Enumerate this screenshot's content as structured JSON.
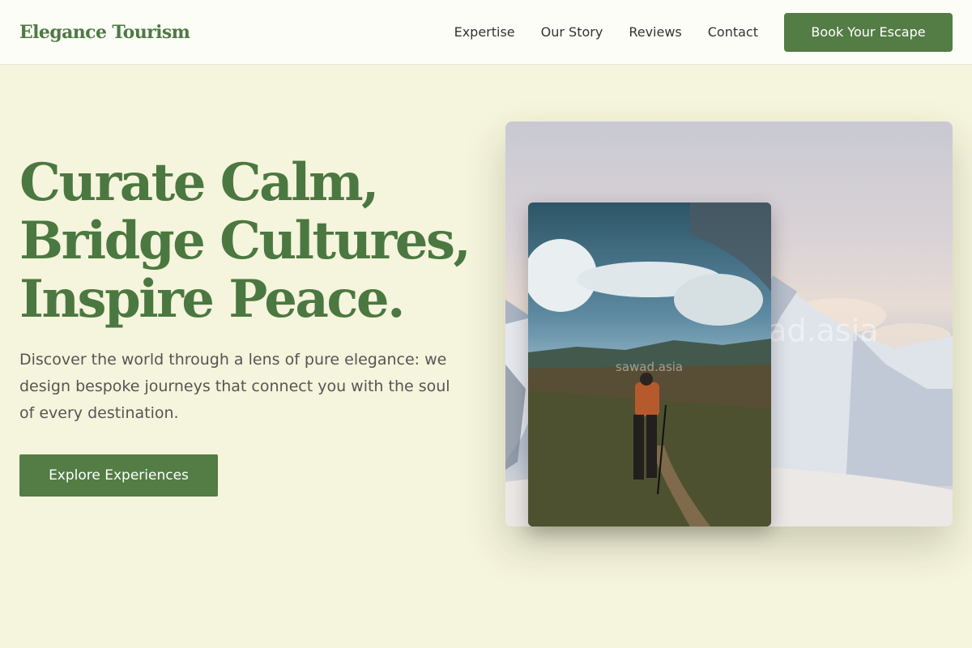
{
  "header": {
    "logo": "Elegance Tourism",
    "nav": [
      "Expertise",
      "Our Story",
      "Reviews",
      "Contact"
    ],
    "cta": "Book Your Escape"
  },
  "hero": {
    "title_lines": [
      "Curate Calm,",
      "Bridge Cultures,",
      "Inspire Peace."
    ],
    "subtitle": "Discover the world through a lens of pure elegance: we design bespoke journeys that connect you with the soul of every destination.",
    "button": "Explore Experiences"
  },
  "images": {
    "main_watermark": "sawad.asia",
    "inset_watermark": "sawad.asia"
  },
  "colors": {
    "brand": "#537d45",
    "background": "#f5f4dc",
    "header_bg": "#fdfdf8"
  }
}
